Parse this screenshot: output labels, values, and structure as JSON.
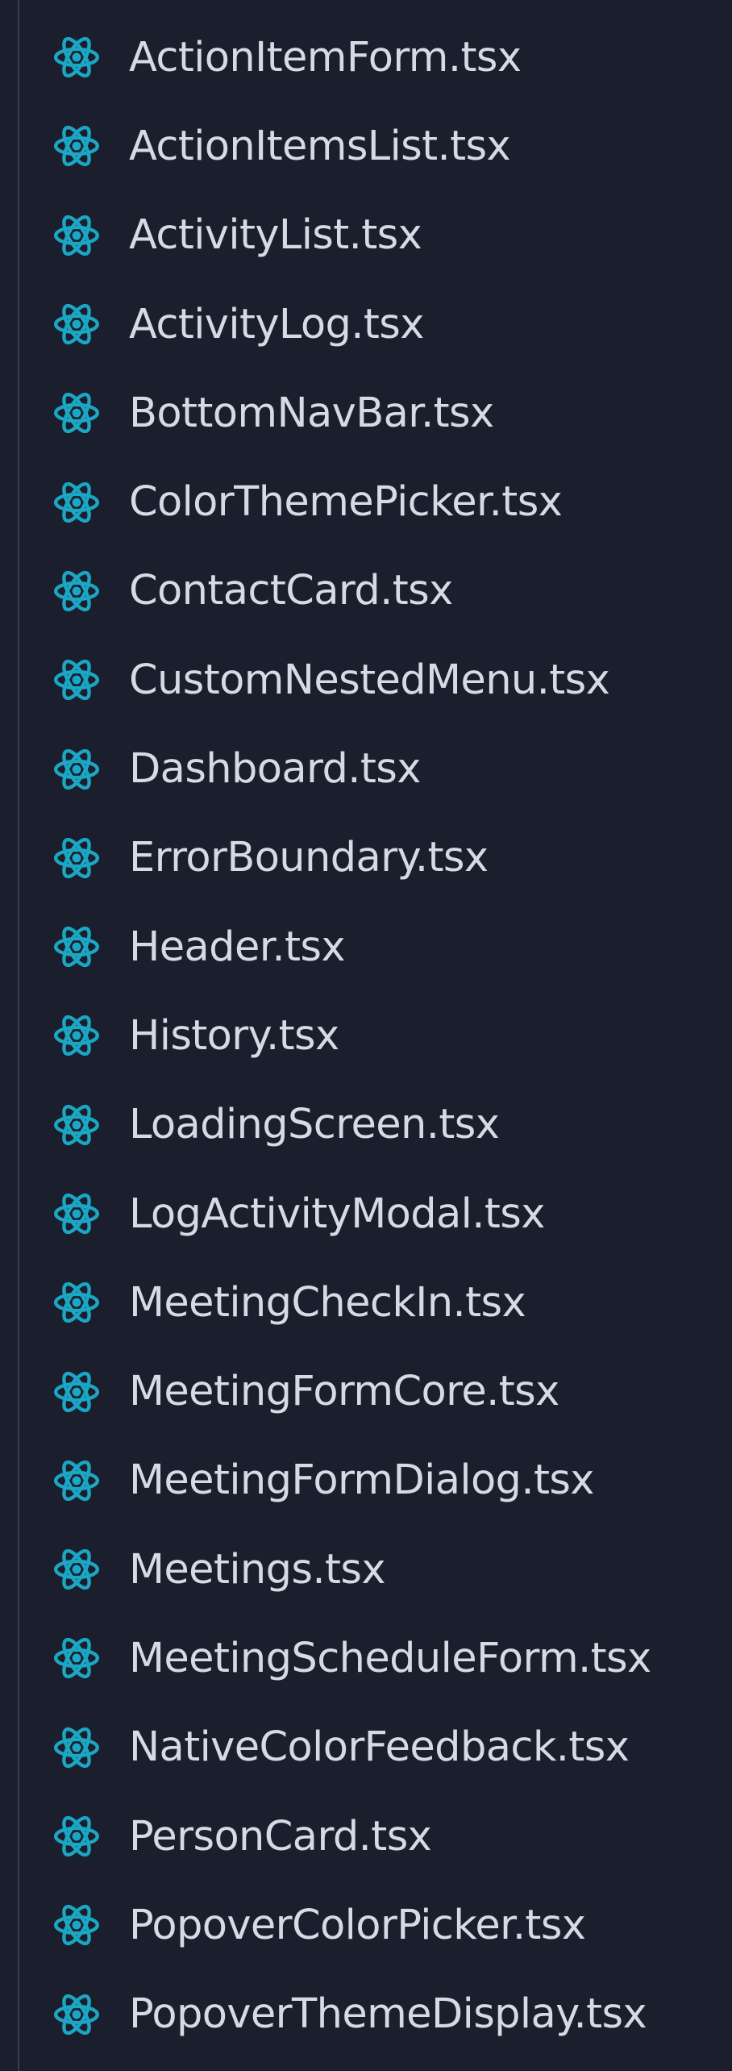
{
  "explorer": {
    "icon_name": "react-icon",
    "icon_color": "#1ba7c4",
    "text_color": "#d6dae4",
    "background_color": "#1b1e2c",
    "files": [
      {
        "name": "ActionItemForm.tsx"
      },
      {
        "name": "ActionItemsList.tsx"
      },
      {
        "name": "ActivityList.tsx"
      },
      {
        "name": "ActivityLog.tsx"
      },
      {
        "name": "BottomNavBar.tsx"
      },
      {
        "name": "ColorThemePicker.tsx"
      },
      {
        "name": "ContactCard.tsx"
      },
      {
        "name": "CustomNestedMenu.tsx"
      },
      {
        "name": "Dashboard.tsx"
      },
      {
        "name": "ErrorBoundary.tsx"
      },
      {
        "name": "Header.tsx"
      },
      {
        "name": "History.tsx"
      },
      {
        "name": "LoadingScreen.tsx"
      },
      {
        "name": "LogActivityModal.tsx"
      },
      {
        "name": "MeetingCheckIn.tsx"
      },
      {
        "name": "MeetingFormCore.tsx"
      },
      {
        "name": "MeetingFormDialog.tsx"
      },
      {
        "name": "Meetings.tsx"
      },
      {
        "name": "MeetingScheduleForm.tsx"
      },
      {
        "name": "NativeColorFeedback.tsx"
      },
      {
        "name": "PersonCard.tsx"
      },
      {
        "name": "PopoverColorPicker.tsx"
      },
      {
        "name": "PopoverThemeDisplay.tsx"
      }
    ]
  }
}
